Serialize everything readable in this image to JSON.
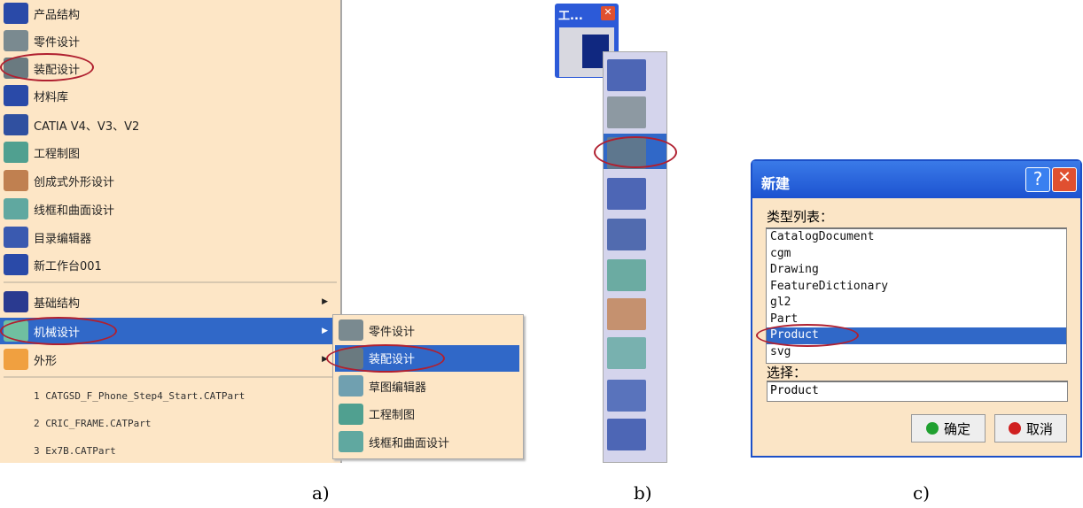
{
  "panel_a": {
    "items": [
      {
        "label": "产品结构",
        "icon": "product-structure-icon"
      },
      {
        "label": "零件设计",
        "icon": "gear-icon"
      },
      {
        "label": "装配设计",
        "icon": "gears-icon"
      },
      {
        "label": "材料库",
        "icon": "material-library-icon"
      },
      {
        "label": "CATIA V4、V3、V2",
        "icon": "catia-icon"
      },
      {
        "label": "工程制图",
        "icon": "drafting-icon"
      },
      {
        "label": "创成式外形设计",
        "icon": "shape-design-icon"
      },
      {
        "label": "线框和曲面设计",
        "icon": "wireframe-surface-icon"
      },
      {
        "label": "目录编辑器",
        "icon": "catalog-editor-icon"
      },
      {
        "label": "新工作台001",
        "icon": "hammer-icon"
      }
    ],
    "categories": [
      {
        "label": "基础结构",
        "icon": "infrastructure-icon"
      },
      {
        "label": "机械设计",
        "icon": "mechanical-design-icon"
      },
      {
        "label": "外形",
        "icon": "shape-icon"
      }
    ],
    "recent_files": [
      "1 CATGSD_F_Phone_Step4_Start.CATPart",
      "2 CRIC_FRAME.CATPart",
      "3 Ex7B.CATPart"
    ],
    "submenu": [
      {
        "label": "零件设计",
        "icon": "gear-icon"
      },
      {
        "label": "装配设计",
        "icon": "gears-icon"
      },
      {
        "label": "草图编辑器",
        "icon": "sketcher-icon"
      },
      {
        "label": "工程制图",
        "icon": "drafting-icon"
      },
      {
        "label": "线框和曲面设计",
        "icon": "wireframe-surface-icon"
      }
    ],
    "caption": "a)"
  },
  "panel_b": {
    "window_title": "工...",
    "tools": [
      "product-structure-icon",
      "gear-icon",
      "gears-icon",
      "material-library-icon",
      "catia-icon",
      "drafting-icon",
      "shape-design-icon",
      "wireframe-surface-icon",
      "catalog-editor-icon",
      "hammer-icon"
    ],
    "caption": "b)"
  },
  "panel_c": {
    "title": "新建",
    "help": "?",
    "type_list_label": "类型列表：",
    "types": [
      "CatalogDocument",
      "cgm",
      "Drawing",
      "FeatureDictionary",
      "gl2",
      "Part",
      "Product",
      "svg"
    ],
    "selected_type": "Product",
    "selection_label": "选择：",
    "selection_value": "Product",
    "ok": "确定",
    "cancel": "取消",
    "caption": "c)"
  },
  "colors": {
    "menu_bg": "#fde6c6",
    "highlight": "#3068c8",
    "annotation": "#b02030",
    "toolbar_bg": "#d4d4ec"
  }
}
